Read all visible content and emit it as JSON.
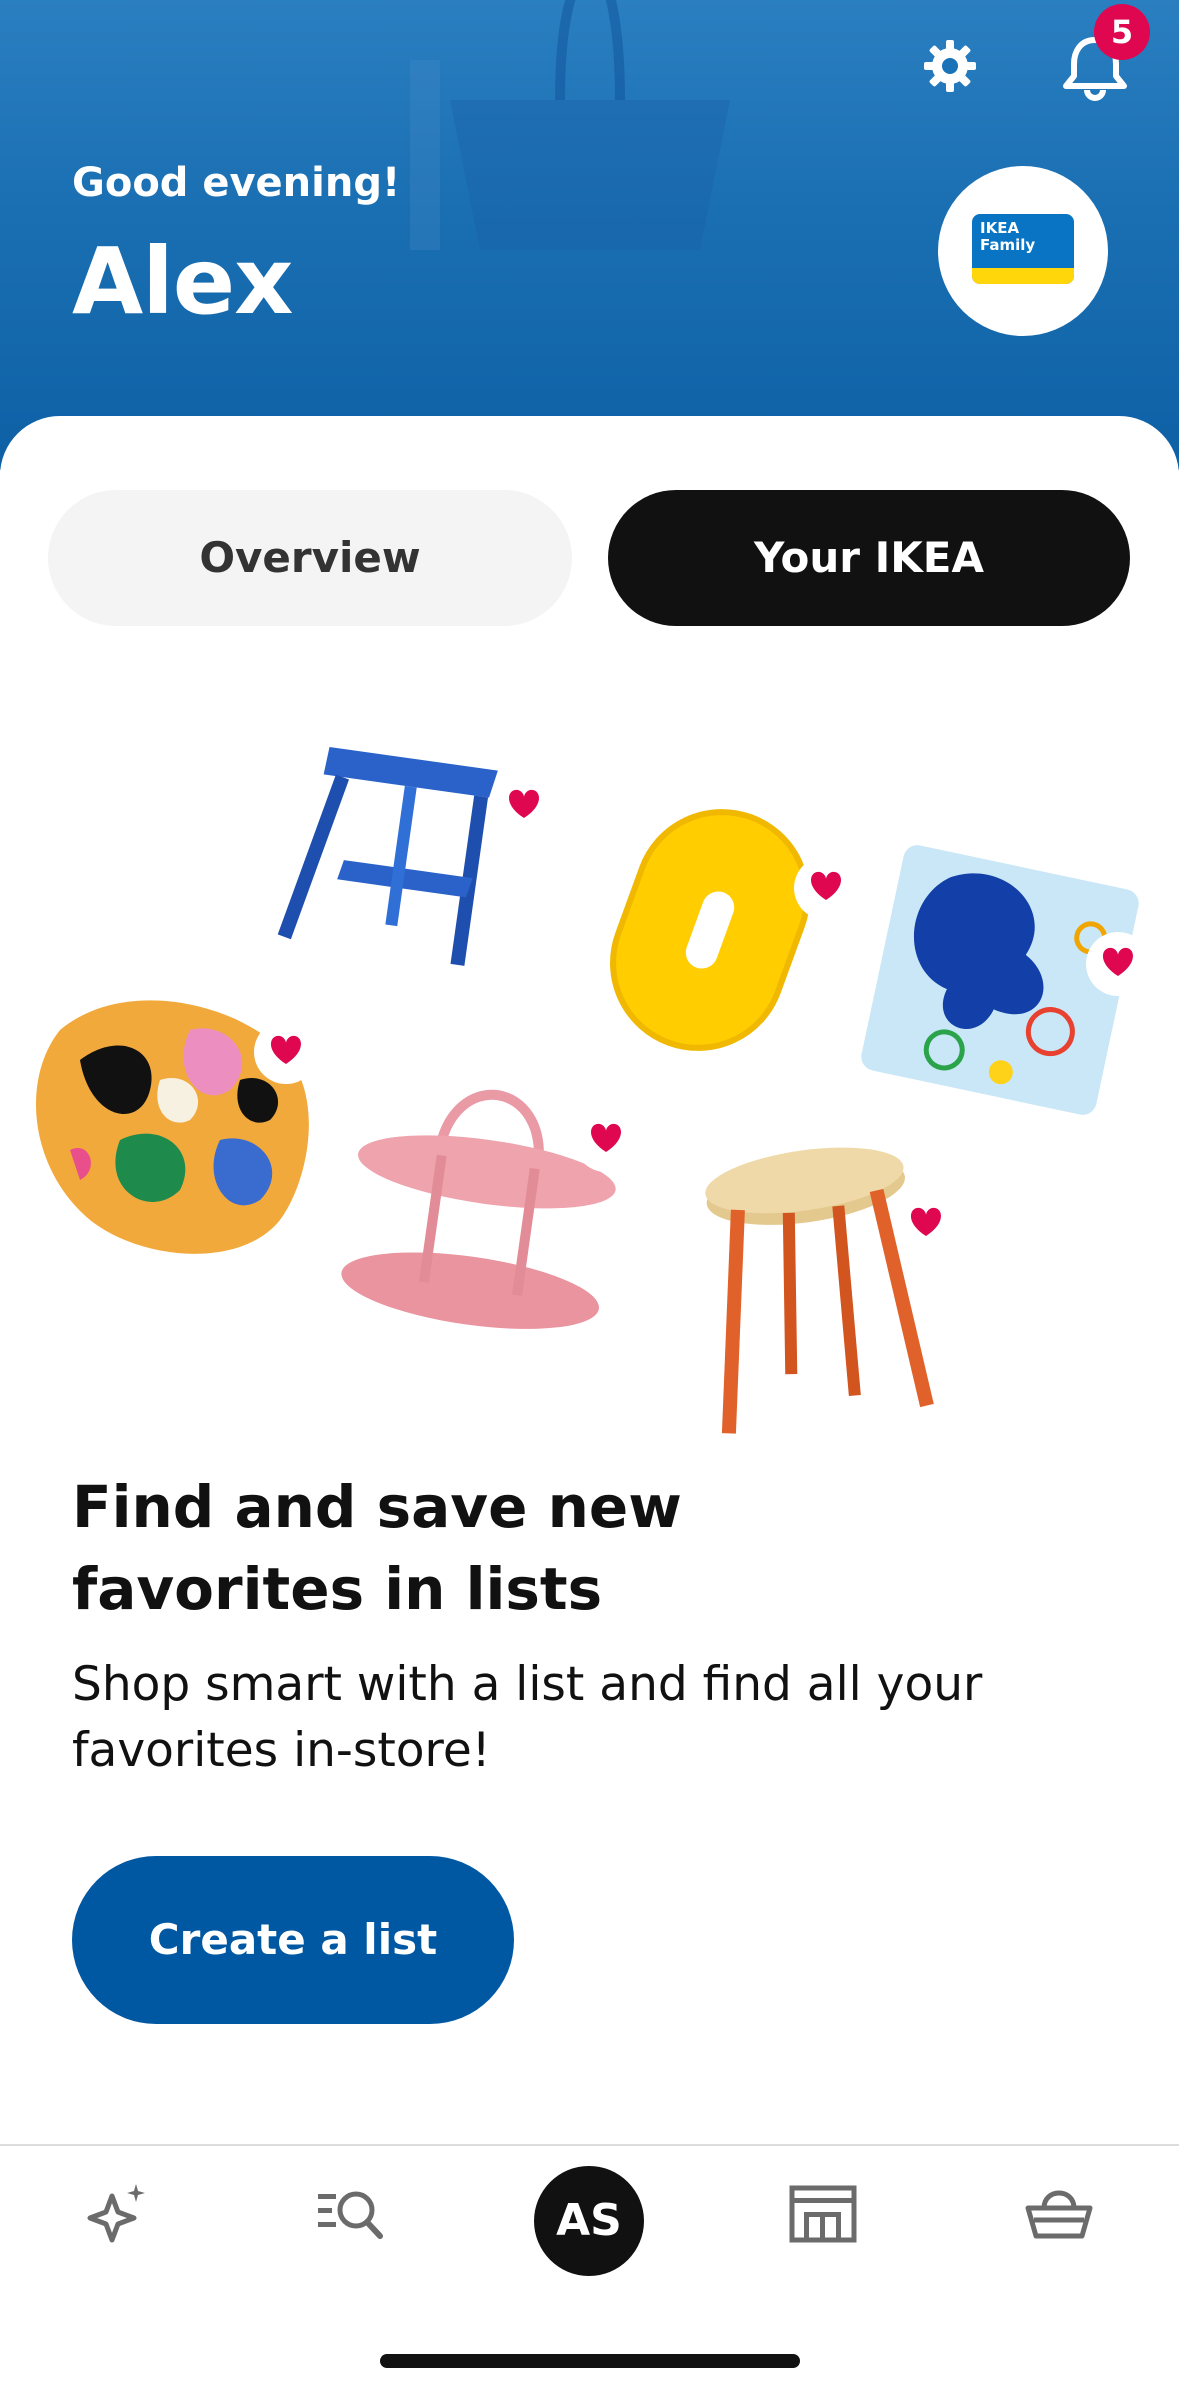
{
  "header": {
    "greeting": "Good evening!",
    "user_name": "Alex",
    "notification_count": "5",
    "family_card_text": "IKEA\nFamily",
    "colors": {
      "header_blue": "#1a6fb2",
      "badge_red": "#e00751",
      "family_yellow": "#ffd60a"
    }
  },
  "tabs": [
    {
      "label": "Overview",
      "selected": false
    },
    {
      "label": "Your IKEA",
      "selected": true
    }
  ],
  "promo": {
    "title": "Find and save new favorites in lists",
    "description": "Shop smart with a list and find all your favorites in-store!",
    "cta_label": "Create a list",
    "cta_color": "#0058a3",
    "illustration_items": [
      "blue-side-table",
      "yellow-sponge",
      "patterned-cushion",
      "colorful-rug",
      "pink-tray-stand",
      "orange-stool"
    ]
  },
  "bottom_nav": {
    "items": [
      "inspiration-icon",
      "search-icon",
      "profile-avatar",
      "store-icon",
      "basket-icon"
    ],
    "avatar_initials": "AS"
  }
}
